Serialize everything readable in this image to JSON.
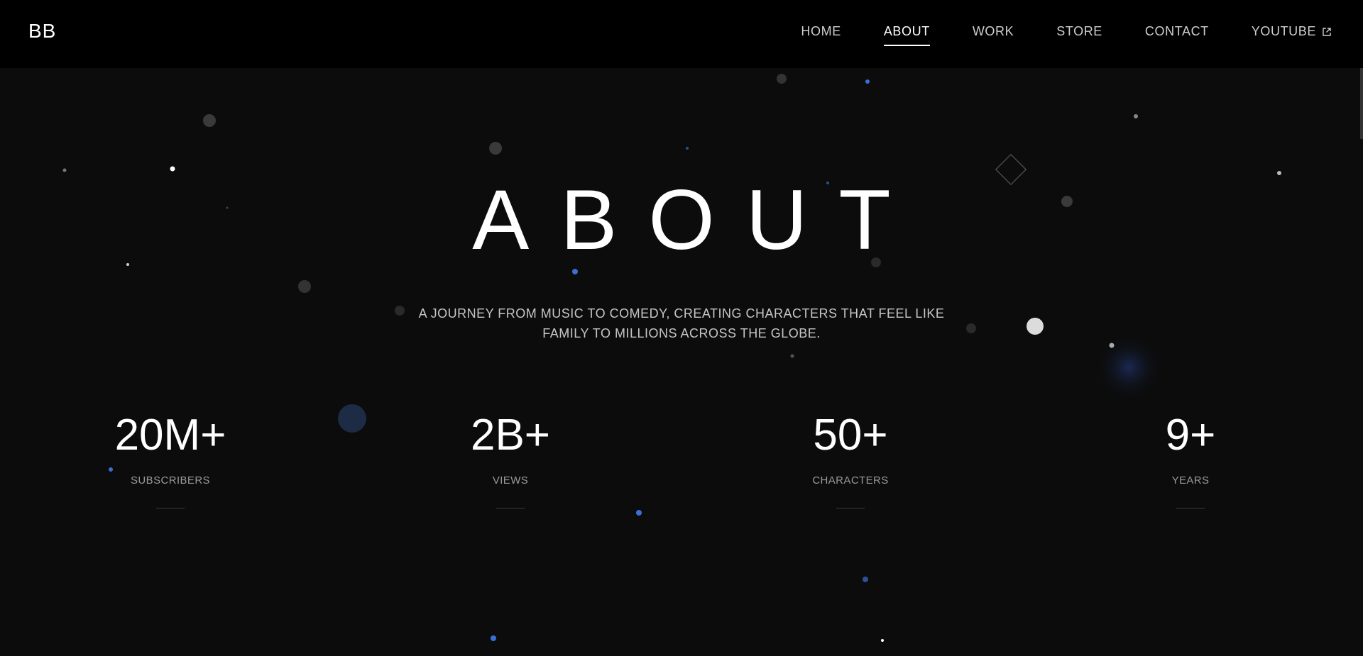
{
  "nav": {
    "logo": "BB",
    "links": [
      {
        "label": "HOME",
        "active": false
      },
      {
        "label": "ABOUT",
        "active": true
      },
      {
        "label": "WORK",
        "active": false
      },
      {
        "label": "STORE",
        "active": false
      },
      {
        "label": "CONTACT",
        "active": false
      },
      {
        "label": "YOUTUBE",
        "active": false,
        "icon": "external-link-icon"
      }
    ]
  },
  "hero": {
    "title": "ABOUT",
    "subtitle": "A JOURNEY FROM MUSIC TO COMEDY, CREATING CHARACTERS THAT FEEL LIKE FAMILY TO MILLIONS ACROSS THE GLOBE."
  },
  "stats": [
    {
      "value": "20M+",
      "label": "SUBSCRIBERS"
    },
    {
      "value": "2B+",
      "label": "VIEWS"
    },
    {
      "value": "50+",
      "label": "CHARACTERS"
    },
    {
      "value": "9+",
      "label": "YEARS"
    }
  ],
  "colors": {
    "background": "#0c0c0c",
    "navbar": "#000000",
    "accent_blue": "#3a6fd8",
    "text": "#ffffff",
    "muted_text": "#9a9a9a"
  }
}
